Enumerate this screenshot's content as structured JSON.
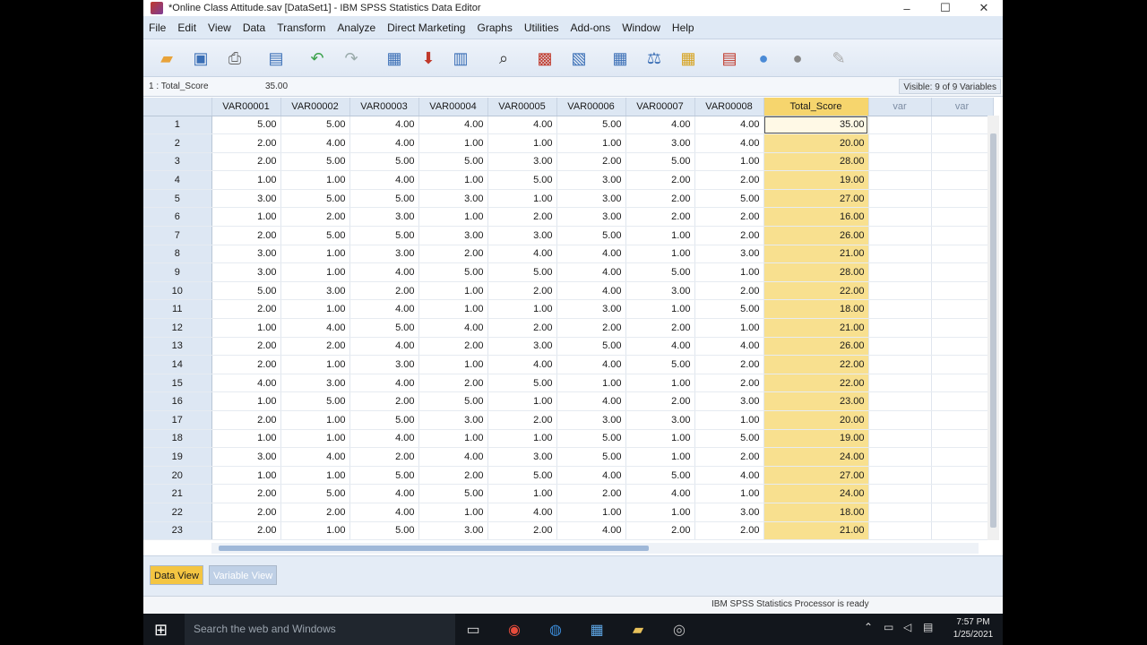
{
  "window": {
    "title": "*Online Class Attitude.sav [DataSet1] - IBM SPSS Statistics Data Editor",
    "controls": {
      "minimize": "–",
      "maximize": "☐",
      "close": "✕"
    }
  },
  "menu": [
    "File",
    "Edit",
    "View",
    "Data",
    "Transform",
    "Analyze",
    "Direct Marketing",
    "Graphs",
    "Utilities",
    "Add-ons",
    "Window",
    "Help"
  ],
  "toolbar": {
    "icons": [
      "open-folder-icon",
      "save-icon",
      "print-icon",
      "recall-dialog-icon",
      "undo-icon",
      "redo-icon",
      "goto-case-icon",
      "goto-variable-icon",
      "variables-icon",
      "find-icon",
      "insert-cases-icon",
      "insert-variable-icon",
      "split-file-icon",
      "weight-cases-icon",
      "select-cases-icon",
      "value-labels-icon",
      "use-sets-icon",
      "show-all-variables-icon",
      "spell-check-icon"
    ]
  },
  "cell_editor": {
    "reference": "1 : Total_Score",
    "value": "35.00",
    "visible_vars": "Visible: 9 of 9 Variables"
  },
  "grid": {
    "columns": [
      "VAR00001",
      "VAR00002",
      "VAR00003",
      "VAR00004",
      "VAR00005",
      "VAR00006",
      "VAR00007",
      "VAR00008",
      "Total_Score",
      "var",
      "var"
    ],
    "rows": [
      [
        "1",
        "5.00",
        "5.00",
        "4.00",
        "4.00",
        "4.00",
        "5.00",
        "4.00",
        "4.00",
        "35.00"
      ],
      [
        "2",
        "2.00",
        "4.00",
        "4.00",
        "1.00",
        "1.00",
        "1.00",
        "3.00",
        "4.00",
        "20.00"
      ],
      [
        "3",
        "2.00",
        "5.00",
        "5.00",
        "5.00",
        "3.00",
        "2.00",
        "5.00",
        "1.00",
        "28.00"
      ],
      [
        "4",
        "1.00",
        "1.00",
        "4.00",
        "1.00",
        "5.00",
        "3.00",
        "2.00",
        "2.00",
        "19.00"
      ],
      [
        "5",
        "3.00",
        "5.00",
        "5.00",
        "3.00",
        "1.00",
        "3.00",
        "2.00",
        "5.00",
        "27.00"
      ],
      [
        "6",
        "1.00",
        "2.00",
        "3.00",
        "1.00",
        "2.00",
        "3.00",
        "2.00",
        "2.00",
        "16.00"
      ],
      [
        "7",
        "2.00",
        "5.00",
        "5.00",
        "3.00",
        "3.00",
        "5.00",
        "1.00",
        "2.00",
        "26.00"
      ],
      [
        "8",
        "3.00",
        "1.00",
        "3.00",
        "2.00",
        "4.00",
        "4.00",
        "1.00",
        "3.00",
        "21.00"
      ],
      [
        "9",
        "3.00",
        "1.00",
        "4.00",
        "5.00",
        "5.00",
        "4.00",
        "5.00",
        "1.00",
        "28.00"
      ],
      [
        "10",
        "5.00",
        "3.00",
        "2.00",
        "1.00",
        "2.00",
        "4.00",
        "3.00",
        "2.00",
        "22.00"
      ],
      [
        "11",
        "2.00",
        "1.00",
        "4.00",
        "1.00",
        "1.00",
        "3.00",
        "1.00",
        "5.00",
        "18.00"
      ],
      [
        "12",
        "1.00",
        "4.00",
        "5.00",
        "4.00",
        "2.00",
        "2.00",
        "2.00",
        "1.00",
        "21.00"
      ],
      [
        "13",
        "2.00",
        "2.00",
        "4.00",
        "2.00",
        "3.00",
        "5.00",
        "4.00",
        "4.00",
        "26.00"
      ],
      [
        "14",
        "2.00",
        "1.00",
        "3.00",
        "1.00",
        "4.00",
        "4.00",
        "5.00",
        "2.00",
        "22.00"
      ],
      [
        "15",
        "4.00",
        "3.00",
        "4.00",
        "2.00",
        "5.00",
        "1.00",
        "1.00",
        "2.00",
        "22.00"
      ],
      [
        "16",
        "1.00",
        "5.00",
        "2.00",
        "5.00",
        "1.00",
        "4.00",
        "2.00",
        "3.00",
        "23.00"
      ],
      [
        "17",
        "2.00",
        "1.00",
        "5.00",
        "3.00",
        "2.00",
        "3.00",
        "3.00",
        "1.00",
        "20.00"
      ],
      [
        "18",
        "1.00",
        "1.00",
        "4.00",
        "1.00",
        "1.00",
        "5.00",
        "1.00",
        "5.00",
        "19.00"
      ],
      [
        "19",
        "3.00",
        "4.00",
        "2.00",
        "4.00",
        "3.00",
        "5.00",
        "1.00",
        "2.00",
        "24.00"
      ],
      [
        "20",
        "1.00",
        "1.00",
        "5.00",
        "2.00",
        "5.00",
        "4.00",
        "5.00",
        "4.00",
        "27.00"
      ],
      [
        "21",
        "2.00",
        "5.00",
        "4.00",
        "5.00",
        "1.00",
        "2.00",
        "4.00",
        "1.00",
        "24.00"
      ],
      [
        "22",
        "2.00",
        "2.00",
        "4.00",
        "1.00",
        "4.00",
        "1.00",
        "1.00",
        "3.00",
        "18.00"
      ],
      [
        "23",
        "2.00",
        "1.00",
        "5.00",
        "3.00",
        "2.00",
        "4.00",
        "2.00",
        "2.00",
        "21.00"
      ]
    ]
  },
  "tabs": {
    "data_view": "Data View",
    "variable_view": "Variable View"
  },
  "status": {
    "message": "IBM SPSS Statistics Processor is ready"
  },
  "taskbar": {
    "search_placeholder": "Search the web and Windows",
    "time": "7:57 PM",
    "date": "1/25/2021"
  }
}
